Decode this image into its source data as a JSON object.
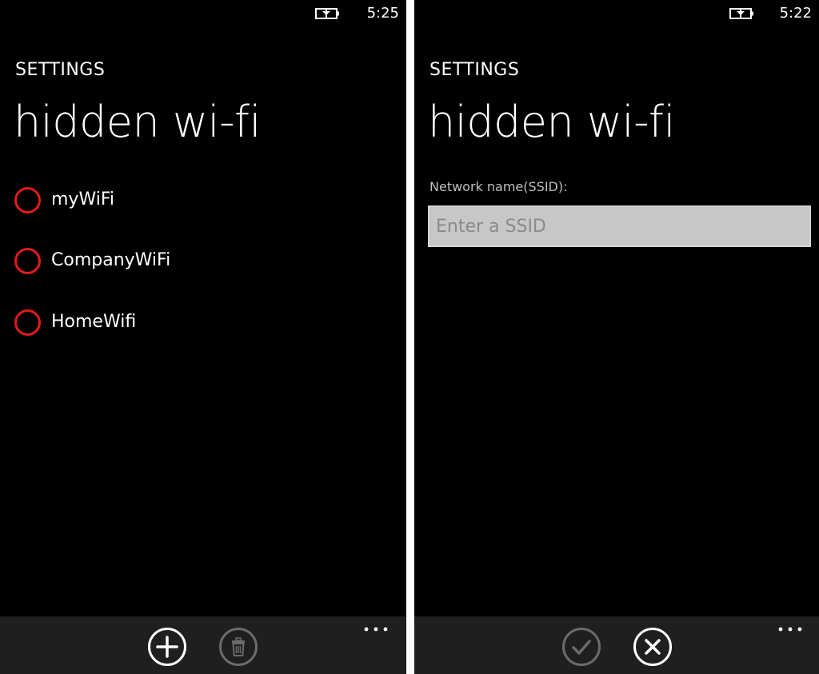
{
  "left_screen": {
    "status": {
      "time": "5:25",
      "battery_icon": "battery-charging-icon"
    },
    "app_title": "SETTINGS",
    "page_title": "hidden wi-fi",
    "networks": [
      {
        "label": "myWiFi"
      },
      {
        "label": "CompanyWiFi"
      },
      {
        "label": "HomeWifi"
      }
    ],
    "app_bar": {
      "buttons": [
        {
          "icon": "add-icon",
          "enabled": true
        },
        {
          "icon": "delete-icon",
          "enabled": false
        }
      ],
      "more_icon": "more-icon"
    }
  },
  "right_screen": {
    "status": {
      "time": "5:22",
      "battery_icon": "battery-charging-icon"
    },
    "app_title": "SETTINGS",
    "page_title": "hidden wi-fi",
    "ssid_field": {
      "label": "Network name(SSID):",
      "value": "",
      "placeholder": "Enter a SSID"
    },
    "app_bar": {
      "buttons": [
        {
          "icon": "check-icon",
          "enabled": false
        },
        {
          "icon": "cancel-icon",
          "enabled": true
        }
      ],
      "more_icon": "more-icon"
    }
  },
  "colors": {
    "accent": "#e51a1a",
    "background": "#000000",
    "app_bar": "#1f1f1f",
    "text": "#ffffff",
    "disabled": "#6b6b6b",
    "input_background": "#c7c7c7"
  }
}
